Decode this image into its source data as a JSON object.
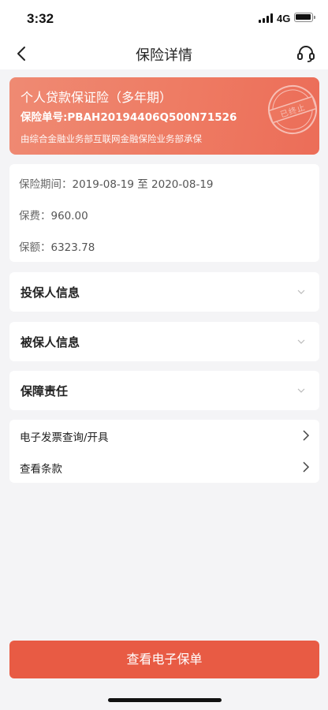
{
  "status_bar": {
    "time": "3:32",
    "network": "4G"
  },
  "nav": {
    "title": "保险详情",
    "back_icon": "chevron-left-icon",
    "support_icon": "headset-icon"
  },
  "policy_card": {
    "name": "个人贷款保证险（多年期）",
    "number_label": "保险单号:PBAH20194406Q500N71526",
    "underwriter": "由综合金融业务部互联网金融保险业务部承保",
    "stamp": "已终止",
    "gradient_colors": [
      "#ef8a73",
      "#ec6d58"
    ]
  },
  "info": {
    "period_label": "保险期间：",
    "period_value": "2019-08-19 至 2020-08-19",
    "premium_label": "保费：",
    "premium_value": "960.00",
    "amount_label": "保额：",
    "amount_value": "6323.78"
  },
  "sections": [
    {
      "title": "投保人信息"
    },
    {
      "title": "被保人信息"
    },
    {
      "title": "保障责任"
    }
  ],
  "links": [
    {
      "label": "电子发票查询/开具"
    },
    {
      "label": "查看条款"
    }
  ],
  "footer": {
    "button_label": "查看电子保单",
    "button_color": "#e85b44"
  }
}
